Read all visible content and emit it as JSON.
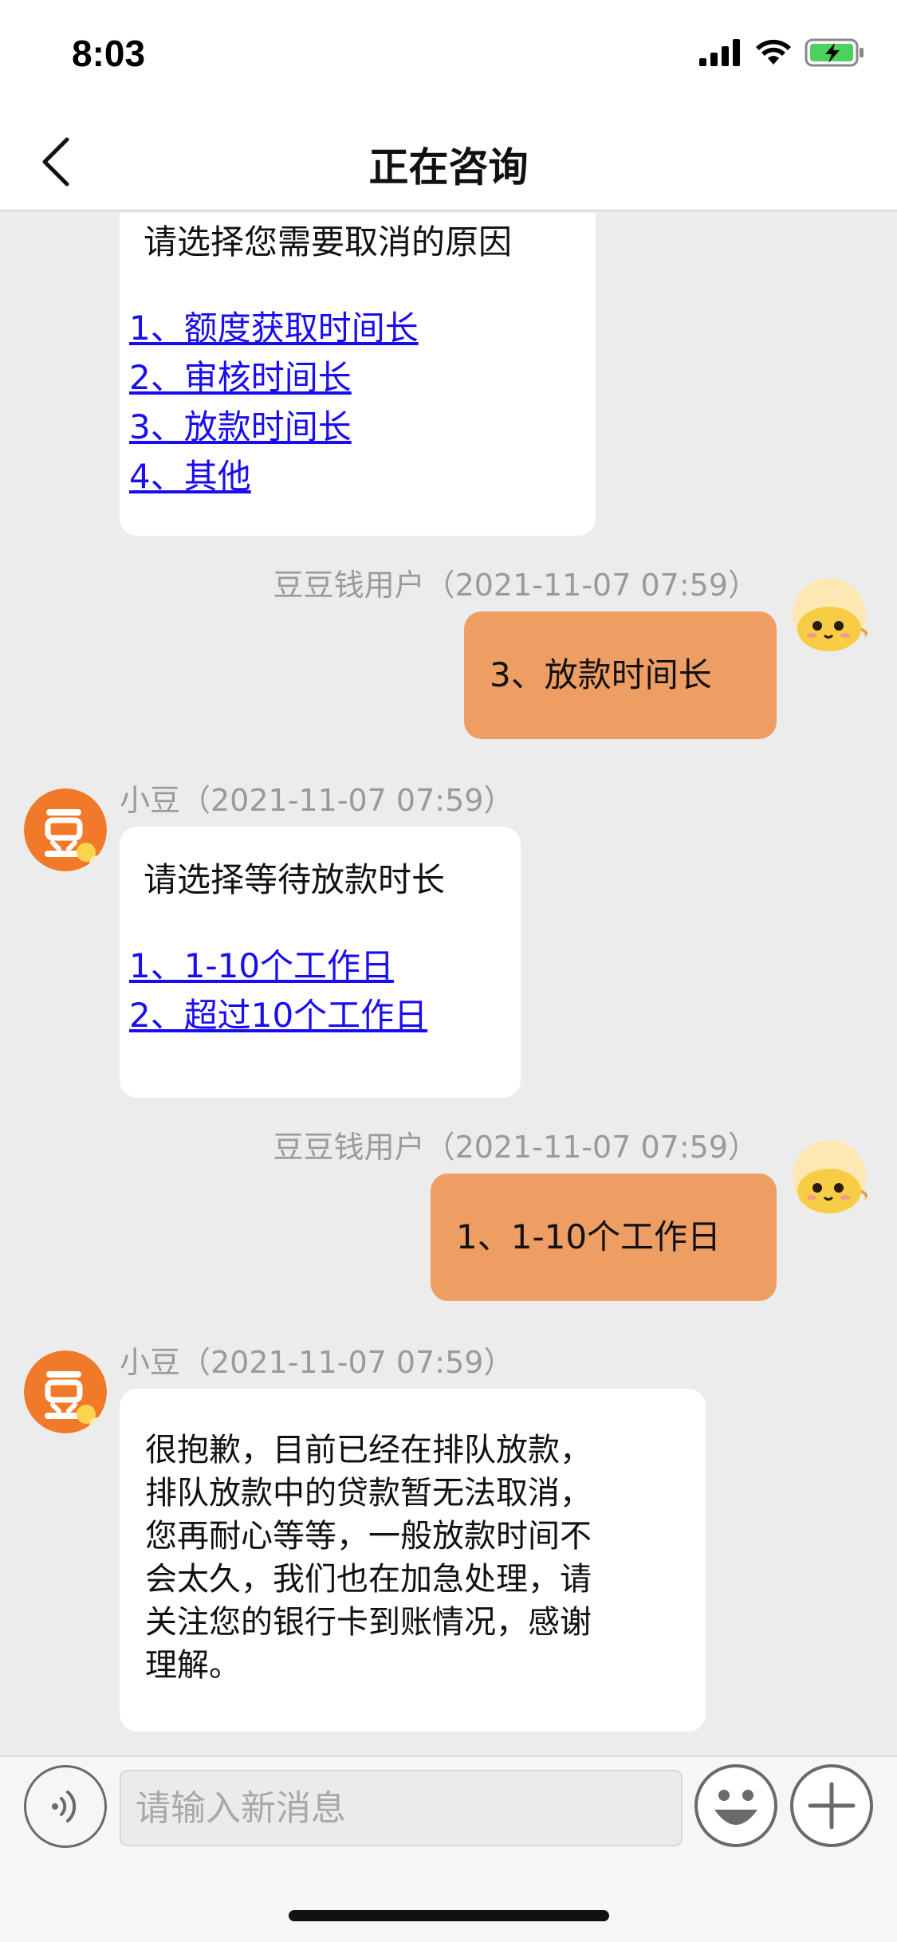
{
  "status_bar": {
    "time": "8:03"
  },
  "header": {
    "title": "正在咨询"
  },
  "messages": [
    {
      "prompt": "请选择您需要取消的原因",
      "options": [
        "1、额度获取时间长",
        "2、审核时间长",
        "3、放款时间长",
        "4、其他"
      ]
    },
    {
      "meta": "豆豆钱用户（2021-11-07 07:59）",
      "text": "3、放款时间长"
    },
    {
      "meta": "小豆（2021-11-07 07:59）",
      "prompt": "请选择等待放款时长",
      "options": [
        "1、1-10个工作日",
        "2、超过10个工作日"
      ]
    },
    {
      "meta": "豆豆钱用户（2021-11-07 07:59）",
      "text": "1、1-10个工作日"
    },
    {
      "meta": "小豆（2021-11-07 07:59）",
      "lines": [
        "很抱歉，目前已经在排队放款，",
        "排队放款中的贷款暂无法取消，",
        "您再耐心等等，一般放款时间不",
        "会太久，我们也在加急处理，请",
        "关注您的银行卡到账情况，感谢",
        "理解。"
      ]
    }
  ],
  "input": {
    "placeholder": "请输入新消息",
    "value": ""
  },
  "colors": {
    "user_bubble": "#ee9e63",
    "link": "#1a0cf0",
    "bot_avatar": "#f07a2a"
  }
}
